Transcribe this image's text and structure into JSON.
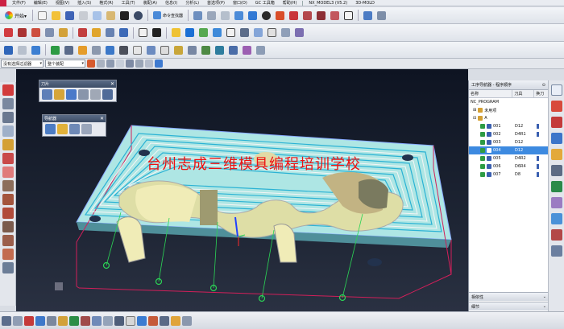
{
  "menubar": {
    "items": [
      "文件(F)",
      "编辑(E)",
      "视图(V)",
      "插入(S)",
      "格式(R)",
      "工具(T)",
      "装配(A)",
      "信息(I)",
      "分析(L)",
      "首选项(P)",
      "窗口(O)",
      "GC 工具箱",
      "帮助(H)"
    ],
    "doc_title": "NX_MODEL3 (V5.2)",
    "app_mode": "3D-MOLD"
  },
  "toolbar1": {
    "start_label": "开始▾",
    "navigator_label": "命令查找器"
  },
  "selection_bar": {
    "filter_value": "没有选择过滤器",
    "scope_value": "整个装配"
  },
  "float_toolbar_1": {
    "title": "刀片"
  },
  "float_toolbar_2": {
    "title": "导航器"
  },
  "watermark": "台州志成三维模具编程培训学校",
  "navigator": {
    "title": "工序导航器 - 程序顺序",
    "columns": [
      "名称",
      "刀具",
      "换刀"
    ],
    "root": "NC_PROGRAM",
    "unused": "未用项",
    "group": "A",
    "operations": [
      {
        "name": "001",
        "tool": "D12"
      },
      {
        "name": "002",
        "tool": "D4R1"
      },
      {
        "name": "003",
        "tool": "D12"
      },
      {
        "name": "004",
        "tool": "D12"
      },
      {
        "name": "005",
        "tool": "D4R2"
      },
      {
        "name": "006",
        "tool": "D6R4"
      },
      {
        "name": "007",
        "tool": "D8"
      }
    ],
    "footer_1": "相依性",
    "footer_2": "细节"
  }
}
